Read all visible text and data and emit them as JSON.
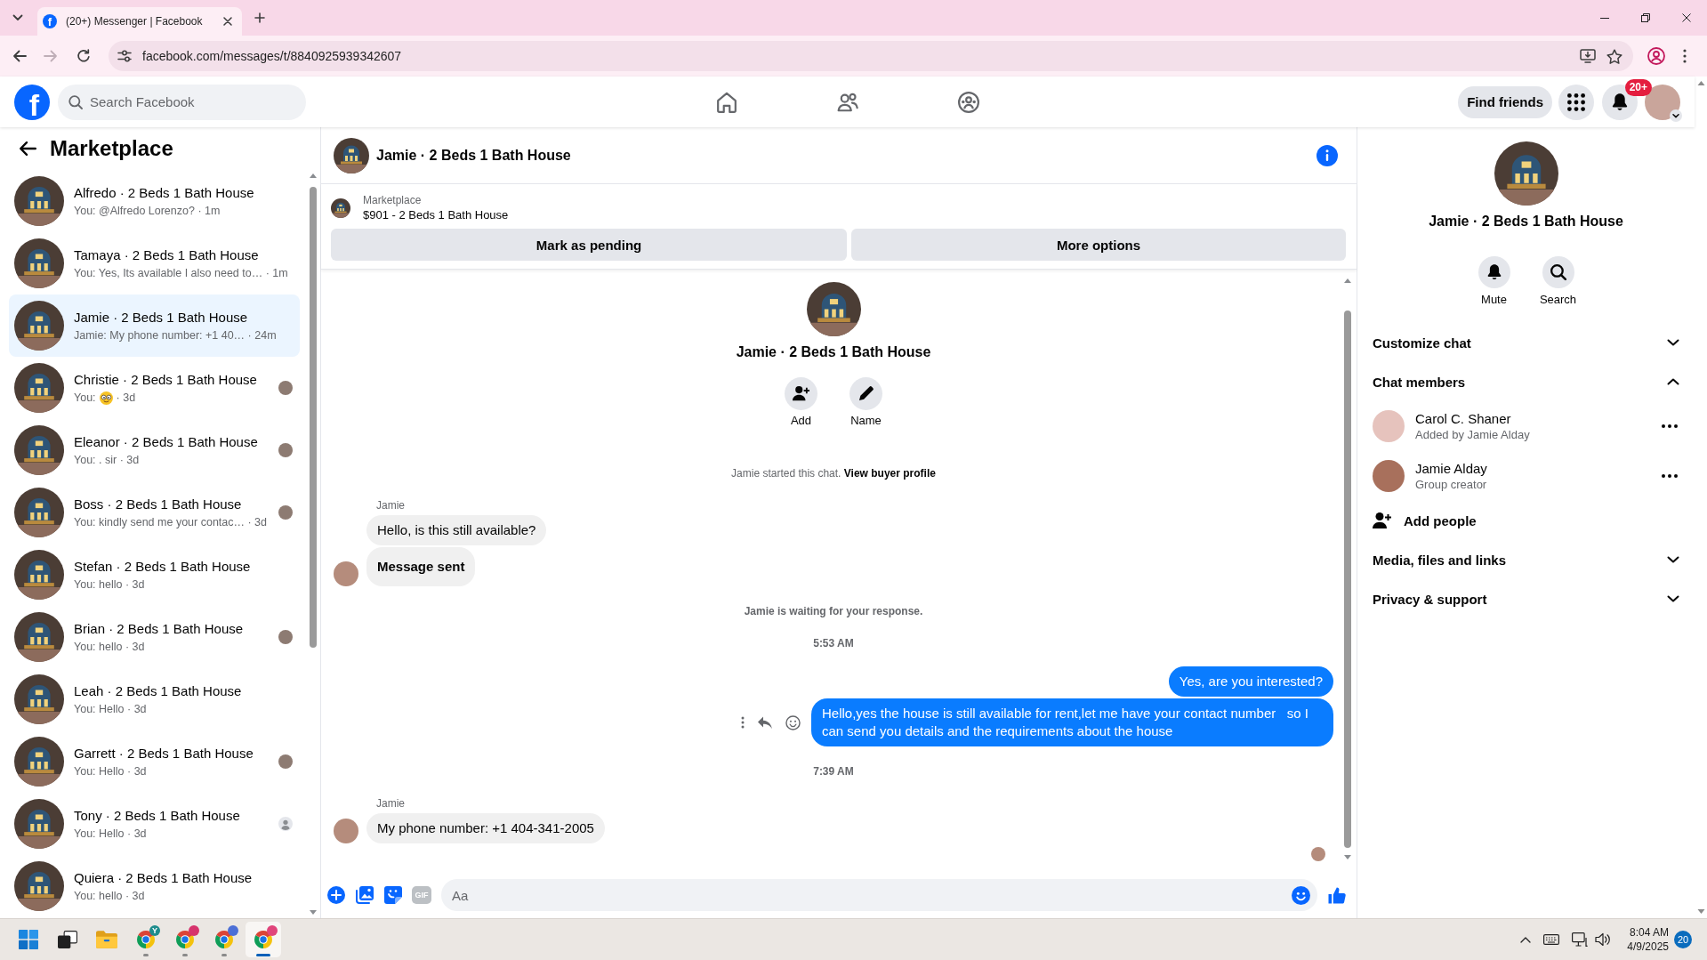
{
  "browser": {
    "tab": {
      "favicon": "f",
      "title": "(20+) Messenger | Facebook",
      "selected": true
    },
    "back_disabled": false,
    "forward_disabled": true,
    "url": "facebook.com/messages/t/8840925939342607"
  },
  "header": {
    "logo": "f",
    "search": {
      "placeholder": "Search Facebook"
    },
    "nav": [
      {
        "kind": "home",
        "selected": false
      },
      {
        "kind": "friends",
        "selected": false
      },
      {
        "kind": "groups",
        "selected": false
      }
    ],
    "find_friends": "Find friends",
    "notification_badge": "20+"
  },
  "sidebar": {
    "title": "Marketplace",
    "items": [
      {
        "name": "Alfredo · 2 Beds 1 Bath House",
        "preview": "You: @Alfredo Lorenzo? · 1m",
        "selected": false
      },
      {
        "name": "Tamaya · 2 Beds 1 Bath House",
        "preview": "You: Yes, Its available I also need to… · 1m",
        "selected": false
      },
      {
        "name": "Jamie · 2 Beds 1 Bath House",
        "preview": "Jamie: My phone number: +1 40… · 24m",
        "selected": true
      },
      {
        "name": "Christie · 2 Beds 1 Bath House",
        "preview": "You:",
        "emoji": true,
        "time": "· 3d",
        "selected": false,
        "read_receipt": {
          "kind": "photo"
        }
      },
      {
        "name": "Eleanor · 2 Beds 1 Bath House",
        "preview": "You: . sir · 3d",
        "selected": false,
        "read_receipt": {
          "kind": "photo"
        }
      },
      {
        "name": "Boss · 2 Beds 1 Bath House",
        "preview": "You: kindly send me your contac… · 3d",
        "selected": false,
        "read_receipt": {
          "kind": "photo"
        }
      },
      {
        "name": "Stefan · 2 Beds 1 Bath House",
        "preview": "You: hello · 3d",
        "selected": false
      },
      {
        "name": "Brian · 2 Beds 1 Bath House",
        "preview": "You: hello · 3d",
        "selected": false,
        "read_receipt": {
          "kind": "photo"
        }
      },
      {
        "name": "Leah · 2 Beds 1 Bath House",
        "preview": "You: Hello · 3d",
        "selected": false
      },
      {
        "name": "Garrett · 2 Beds 1 Bath House",
        "preview": "You: Hello · 3d",
        "selected": false,
        "read_receipt": {
          "kind": "photo"
        }
      },
      {
        "name": "Tony · 2 Beds 1 Bath House",
        "preview": "You: Hello · 3d",
        "selected": false,
        "read_receipt": {
          "kind": "silhouette"
        }
      },
      {
        "name": "Quiera · 2 Beds 1 Bath House",
        "preview": "You: hello · 3d",
        "selected": false
      }
    ]
  },
  "chat": {
    "title": "Jamie · 2 Beds 1 Bath House",
    "listing": {
      "label": "Marketplace",
      "title": "$901 - 2 Beds 1 Bath House"
    },
    "buttons": [
      "Mark as pending",
      "More options"
    ],
    "intro": {
      "title": "Jamie · 2 Beds 1 Bath House",
      "actions": [
        {
          "kind": "add",
          "label": "Add"
        },
        {
          "kind": "name",
          "label": "Name"
        }
      ],
      "notice": "Jamie started this chat.",
      "link": "View buyer profile"
    },
    "messages": [
      {
        "kind": "sender",
        "text": "Jamie"
      },
      {
        "kind": "incoming",
        "text": "Hello, is this still available?",
        "avatar": false,
        "bold": false
      },
      {
        "kind": "incoming",
        "text": "Message sent",
        "avatar": true,
        "bold": true
      },
      {
        "kind": "status",
        "text": "Jamie is waiting for your response."
      },
      {
        "kind": "time",
        "text": "5:53 AM"
      },
      {
        "kind": "outgoing",
        "text": "Yes, are you interested?",
        "hovered": false
      },
      {
        "kind": "outgoing",
        "text": "Hello,yes the house is still available for rent,let me have your contact number   so I can send you details and the requirements about the house",
        "hovered": true
      },
      {
        "kind": "time",
        "text": "7:39 AM"
      },
      {
        "kind": "sender",
        "text": "Jamie"
      },
      {
        "kind": "incoming",
        "text": "My phone number: +1 404-341-2005",
        "avatar": true,
        "bold": false
      }
    ],
    "seen": true,
    "composer": {
      "gif": "GIF",
      "placeholder": "Aa"
    }
  },
  "details": {
    "title": "Jamie · 2 Beds 1 Bath House",
    "actions": [
      {
        "kind": "mute",
        "label": "Mute"
      },
      {
        "kind": "search",
        "label": "Search"
      }
    ],
    "sections": [
      {
        "label": "Customize chat",
        "expanded": false
      },
      {
        "label": "Chat members",
        "expanded": true,
        "members": [
          {
            "name": "Carol C. Shaner",
            "role": "Added by Jamie Alday"
          },
          {
            "name": "Jamie Alday",
            "role": "Group creator"
          }
        ],
        "add_label": "Add people"
      },
      {
        "label": "Media, files and links",
        "expanded": false
      },
      {
        "label": "Privacy & support",
        "expanded": false
      }
    ]
  },
  "taskbar": {
    "apps": [
      {
        "kind": "start",
        "running": false,
        "selected": false
      },
      {
        "kind": "task-view",
        "running": false,
        "selected": false
      },
      {
        "kind": "explorer",
        "running": false,
        "selected": false
      },
      {
        "kind": "browser",
        "running": true,
        "selected": false,
        "badge": "Y",
        "color": "#1e8c8c"
      },
      {
        "kind": "browser",
        "running": true,
        "selected": false,
        "color": "#d6336c"
      },
      {
        "kind": "browser",
        "running": true,
        "selected": false,
        "color": "#4c6fd6"
      },
      {
        "kind": "browser",
        "running": true,
        "selected": true,
        "color": "#e0457b"
      }
    ],
    "time": "8:04 AM",
    "date": "4/9/2025",
    "notifications": "20"
  }
}
